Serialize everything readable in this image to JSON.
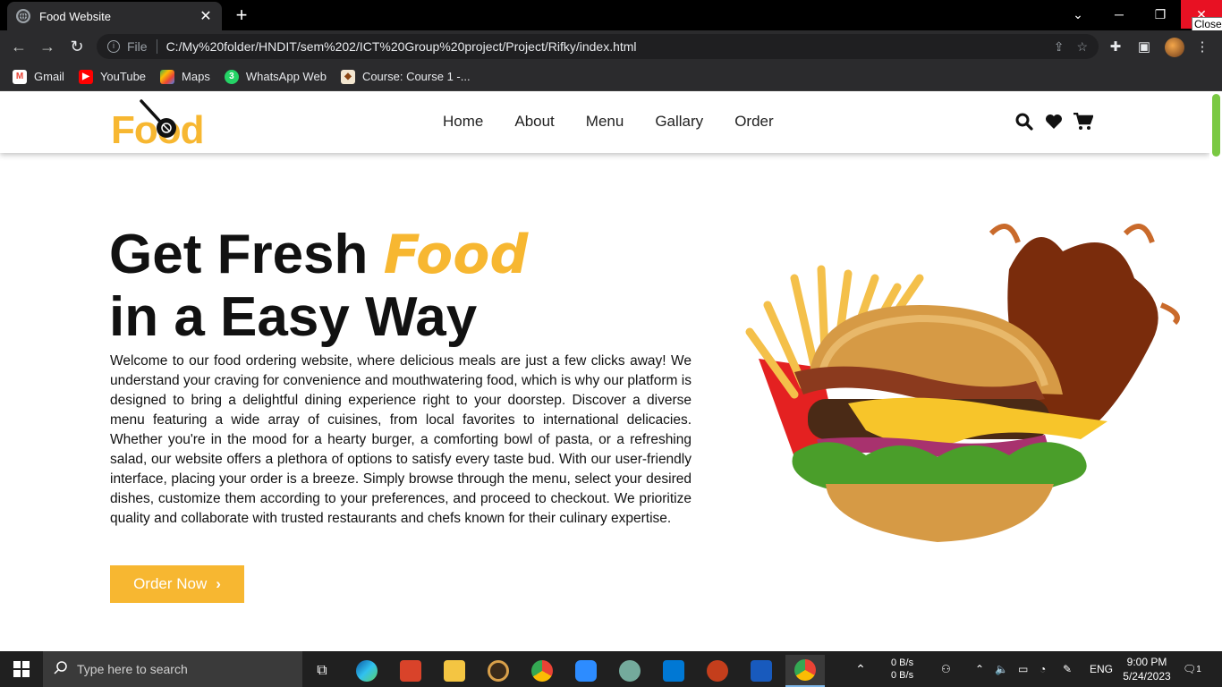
{
  "browser": {
    "tab_title": "Food Website",
    "tooltip": "Close",
    "url_scheme": "File",
    "url": "C:/My%20folder/HNDIT/sem%202/ICT%20Group%20project/Project/Rifky/index.html",
    "bookmarks": [
      {
        "label": "Gmail",
        "color": "#ea4335"
      },
      {
        "label": "YouTube",
        "color": "#ff0000"
      },
      {
        "label": "Maps",
        "color": "#34a853"
      },
      {
        "label": "WhatsApp Web",
        "color": "#25d366"
      },
      {
        "label": "Course: Course 1 -...",
        "color": "#8b4513"
      }
    ]
  },
  "site": {
    "logo": "Food",
    "nav": [
      "Home",
      "About",
      "Menu",
      "Gallary",
      "Order"
    ],
    "header_icons": [
      "search-icon",
      "heart-icon",
      "cart-icon"
    ],
    "accent_color": "#f7b731",
    "hero": {
      "title_part1": "Get Fresh ",
      "title_accent": "Food",
      "title_line2": "in a Easy Way",
      "description": "Welcome to our food ordering website, where delicious meals are just a few clicks away! We understand your craving for convenience and mouthwatering food, which is why our platform is designed to bring a delightful dining experience right to your doorstep. Discover a diverse menu featuring a wide array of cuisines, from local favorites to international delicacies. Whether you're in the mood for a hearty burger, a comforting bowl of pasta, or a refreshing salad, our website offers a plethora of options to satisfy every taste bud. With our user-friendly interface, placing your order is a breeze. Simply browse through the menu, select your desired dishes, customize them according to your preferences, and proceed to checkout. We prioritize quality and collaborate with trusted restaurants and chefs known for their culinary expertise.",
      "cta": "Order Now"
    }
  },
  "taskbar": {
    "search_placeholder": "Type here to search",
    "net_up": "0 B/s",
    "net_down": "0 B/s",
    "lang": "ENG",
    "time": "9:00 PM",
    "date": "5/24/2023",
    "notifications": "1"
  }
}
